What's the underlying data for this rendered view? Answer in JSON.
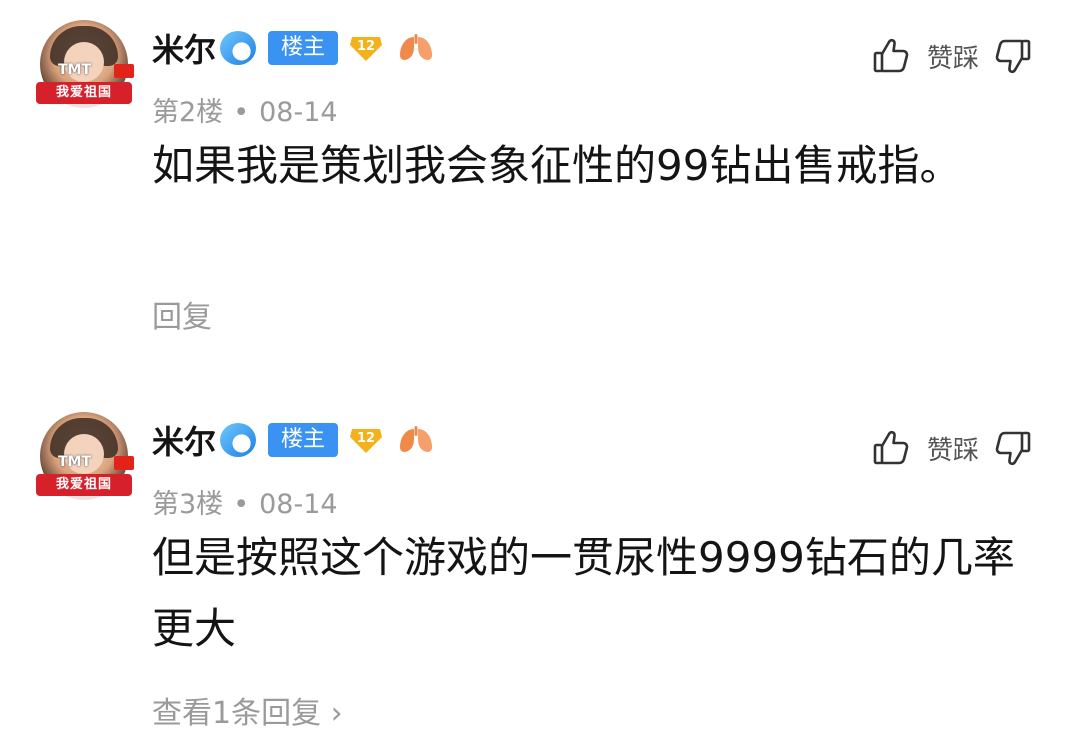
{
  "posts": [
    {
      "username": "米尔",
      "badge": "楼主",
      "level": "12",
      "avatar_text": "我爱祖国",
      "avatar_tag": "TMT",
      "floor": "第2楼",
      "date": "08-14",
      "content": "如果我是策划我会象征性的99钻出售戒指。",
      "reply_label": "回复",
      "like_action": "赞踩"
    },
    {
      "username": "米尔",
      "badge": "楼主",
      "level": "12",
      "avatar_text": "我爱祖国",
      "avatar_tag": "TMT",
      "floor": "第3楼",
      "date": "08-14",
      "content": "但是按照这个游戏的一贯尿性9999钻石的几率更大",
      "reply_label": "查看1条回复 ›",
      "like_action": "赞踩"
    }
  ],
  "meta_separator": "•",
  "colors": {
    "accent": "#3a92f2",
    "muted": "#9a9a9a",
    "text": "#141414",
    "level_badge": "#f3b21c",
    "lung_icon": "#f08a4b"
  },
  "icons": [
    "wave-icon",
    "level-badge-icon",
    "lung-icon",
    "thumb-up-icon",
    "thumb-down-icon"
  ]
}
